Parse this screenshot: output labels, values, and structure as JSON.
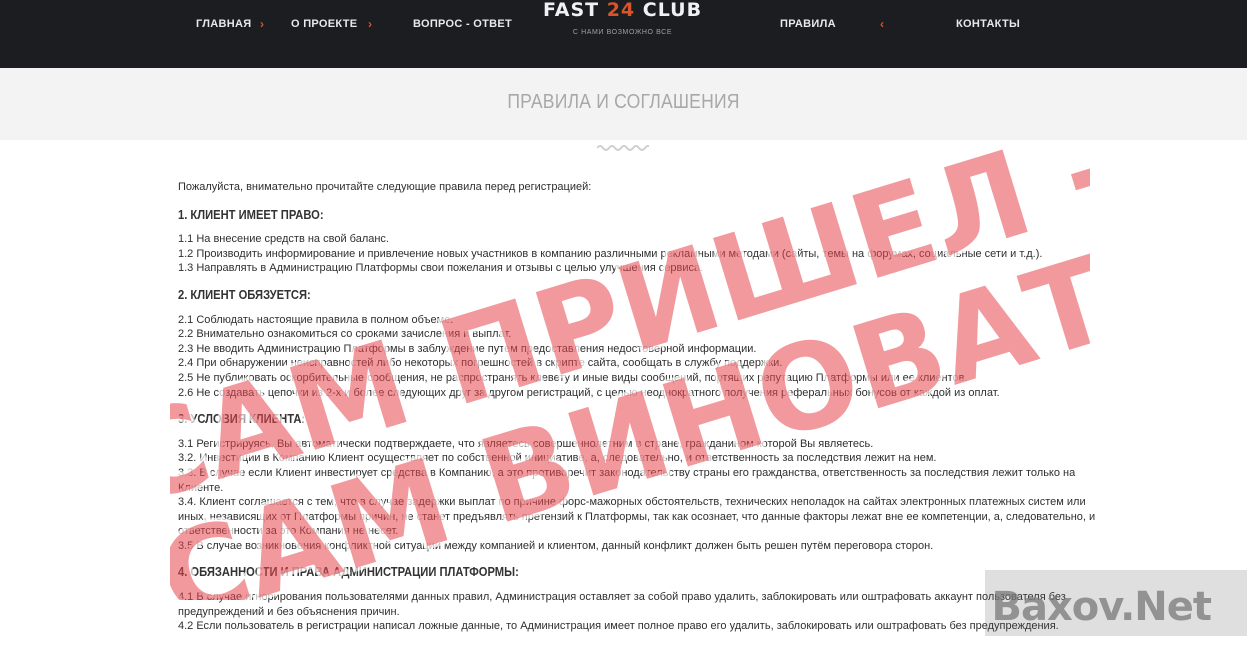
{
  "nav": {
    "items": [
      {
        "label": "ГЛАВНАЯ"
      },
      {
        "label": "О ПРОЕКТЕ"
      },
      {
        "label": "ВОПРОС - ОТВЕТ"
      },
      {
        "label": "ПРАВИЛА"
      },
      {
        "label": "КОНТАКТЫ"
      }
    ],
    "sep_right": "›",
    "sep_left": "‹"
  },
  "logo": {
    "word1": "FAST ",
    "number": "24",
    "word2": " CLUB",
    "tagline": "С НАМИ ВОЗМОЖНО ВСЕ"
  },
  "page_title": "ПРАВИЛА И СОГЛАШЕНИЯ",
  "intro": "Пожалуйста, внимательно прочитайте следующие правила перед регистрацией:",
  "sections": [
    {
      "heading": "1. КЛИЕНТ ИМЕЕТ ПРАВО:",
      "items": [
        "1.1 На внесение средств на свой баланс.",
        "1.2 Производить информирование и привлечение новых участников в компанию различными рекламными методами (сайты, темы на форумах, социальные сети и т.д.).",
        "1.3 Направлять в Администрацию Платформы свои пожелания и отзывы с целью улучшения сервиса."
      ]
    },
    {
      "heading": "2. КЛИЕНТ ОБЯЗУЕТСЯ:",
      "items": [
        "2.1 Соблюдать настоящие правила в полном объеме.",
        "2.2 Внимательно ознакомиться со сроками зачисления и выплат.",
        "2.3 Не вводить Администрацию Платформы в заблуждение путем предоставления недостоверной информации.",
        "2.4 При обнаружении неисправностей либо некоторых погрешностей в скрипте сайта, сообщать в службу поддержки.",
        "2.5 Не публиковать оскорбительные сообщения, не распространять клевету и иные виды сообщений, портящих репутацию Платформы или ее клиентов.",
        "2.6 Не создавать цепочки из 2-х и более следующих друг за другом регистраций, с целью неоднократного получения реферальных бонусов от каждой из оплат."
      ]
    },
    {
      "heading": "3. УСЛОВИЯ КЛИЕНТА:",
      "items": [
        "3.1 Регистрируясь, Вы автоматически подтверждаете, что являетесь совершеннолетним в стране, гражданином которой Вы являетесь.",
        "3.2. Инвестиции в Компанию Клиент осуществляет по собственной инициативе, а, следовательно, и ответственность за последствия лежит на нем.",
        "3.3. В случае если Клиент инвестирует средства в Компанию, а это противоречит законодательству страны его гражданства, ответственность за последствия лежит только на Клиенте.",
        "3.4. Клиент соглашается с тем, что в случае задержки выплат по причине форс-мажорных обстоятельств, технических неполадок на сайтах электронных платежных систем или иных, независящих от Платформы причин, не станет предъявлять претензий к Платформы, так как осознает, что данные факторы лежат вне ее компетенции, а, следовательно, и ответственности за это Компания не несет.",
        "3.5 В случае возникновения конфликтной ситуации между компанией и клиентом, данный конфликт должен быть решен путём переговора сторон."
      ]
    },
    {
      "heading": "4. ОБЯЗАННОСТИ И ПРАВА АДМИНИСТРАЦИИ ПЛАТФОРМЫ:",
      "items": [
        "4.1 В случае игнорирования пользователями данных правил, Администрация оставляет за собой право удалить, заблокировать или оштрафовать аккаунт пользователя без предупреждений и без объяснения причин.",
        "4.2 Если пользователь в регистрации написал ложные данные, то Администрация имеет полное право его удалить, заблокировать или оштрафовать без предупреждения."
      ]
    }
  ],
  "watermark": {
    "line1": "САМ ПРИШЕЛ -",
    "line2": "САМ ВИНОВАТ",
    "color": "#e8454d"
  },
  "corner_logo": "Baxov.Net",
  "colors": {
    "nav_bg": "#1c1d21",
    "accent": "#d8542b",
    "title_gray": "#a8a8a8"
  }
}
